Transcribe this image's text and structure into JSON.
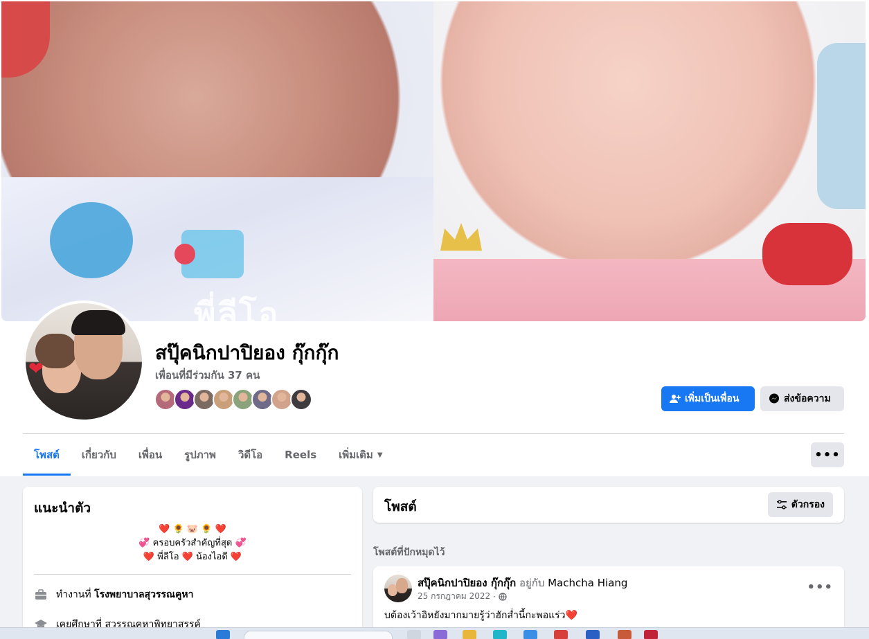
{
  "cover": {
    "overlay_text": "พี่ลีโอ"
  },
  "profile": {
    "name": "สปุ๊คนิกปาปิยอง กุ๊กกุ๊ก",
    "mutual_friends": "เพื่อนที่มีร่วมกัน 37 คน",
    "mutual_friend_avatar_colors": [
      "#b56a7a",
      "#6a2a8a",
      "#7a6a62",
      "#c9a07a",
      "#8aa37a",
      "#6f6a88",
      "#d2a38c",
      "#3e3b3e"
    ]
  },
  "actions": {
    "add_friend": "เพิ่มเป็นเพื่อน",
    "message": "ส่งข้อความ",
    "more": "•••"
  },
  "tabs": [
    {
      "label": "โพสต์",
      "active": true
    },
    {
      "label": "เกี่ยวกับ",
      "active": false
    },
    {
      "label": "เพื่อน",
      "active": false
    },
    {
      "label": "รูปภาพ",
      "active": false
    },
    {
      "label": "วิดีโอ",
      "active": false
    },
    {
      "label": "Reels",
      "active": false
    },
    {
      "label": "เพิ่มเติม",
      "active": false
    }
  ],
  "intro": {
    "title": "แนะนำตัว",
    "bio_line1": "❤️ 🌻 🐷 🌻 ❤️",
    "bio_line2": "💞 ครอบครัวสำคัญที่สุด 💞",
    "bio_line3": "❤️ พี่ลีโอ ❤️ น้องไอดี ❤️",
    "work_prefix": "ทำงานที่",
    "work_place": "โรงพยาบาลสุวรรณคูหา",
    "edu_prefix": "เคยศึกษาที่",
    "edu_place": "สุวรรณคูหาพิทยาสรรค์"
  },
  "posts": {
    "title": "โพสต์",
    "filter": "ตัวกรอง",
    "pinned_label": "โพสต์ที่ปักหมุดไว้"
  },
  "post": {
    "author": "สปุ๊คนิกปาปิยอง กุ๊กกุ๊ก",
    "with_text": "อยู่กับ",
    "tagged": "Machcha Hiang",
    "date": "25 กรกฎาคม 2022",
    "dot": "·",
    "text": "บต้องเว้าอิหยังมากมายรู้ว่าฮักส่ำนี้กะพอแร่ว❤️"
  },
  "colors": {
    "accent": "#1877f2",
    "secondary_button": "#e4e6eb",
    "muted_text": "#65676b"
  }
}
